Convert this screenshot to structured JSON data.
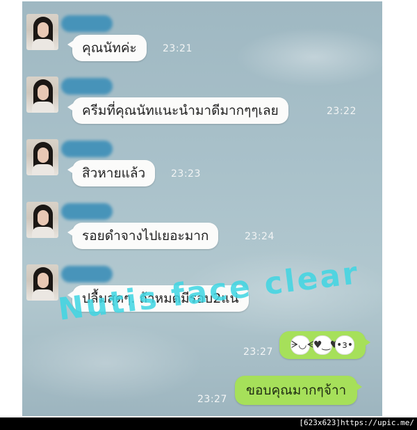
{
  "messages": [
    {
      "text": "คุณนัทค่ะ",
      "time": "23:21"
    },
    {
      "text": "ครีมที่คุณนัทแนะนำมาดีมากๆๆเลย",
      "time": "23:22"
    },
    {
      "text": "สิวหายแล้ว",
      "time": "23:23"
    },
    {
      "text": "รอยดำจางไปเยอะมาก",
      "time": "23:24"
    },
    {
      "text": "ปลื้มสุดๆ. ถ้าหมดมีรอบ2แน่",
      "time": ""
    }
  ],
  "replies": [
    {
      "time": "23:27",
      "stickers": [
        "laughing-face-icon",
        "heart-eyes-face-icon",
        "bunny-kiss-icon"
      ]
    },
    {
      "text": "ขอบคุณมากๆจ้าา",
      "time": "23:27"
    }
  ],
  "watermark": "Nutis face clear",
  "caption": "[623x623]https://upic.me/",
  "colors": {
    "incoming_bubble": "#fbfbfa",
    "outgoing_bubble": "#a6e05a",
    "watermark": "#3fd6e3"
  }
}
